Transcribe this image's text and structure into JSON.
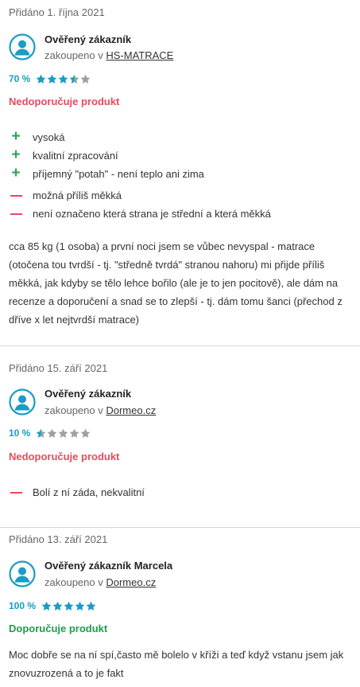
{
  "reviews": [
    {
      "date": "Přidáno 1. října 2021",
      "author": "Ověřený zákazník",
      "bought_prefix": "zakoupeno v",
      "shop": "HS-MATRACE",
      "rating_pct": "70 %",
      "rating_value": 3.5,
      "verdict": "Nedoporučuje produkt",
      "verdict_type": "negative",
      "pros": [
        "vysoká",
        "kvalitní zpracování",
        "příjemný \"potah\" - není teplo ani zima"
      ],
      "cons": [
        "možná příliš měkká",
        "není označeno která strana je střední a která měkká"
      ],
      "text": "cca 85 kg (1 osoba) a první noci jsem se vůbec nevyspal - matrace (otočena tou tvrdší - tj. \"středně tvrdá\" stranou nahoru) mi přijde příliš měkká, jak kdyby se tělo lehce bořilo (ale je to jen pocitově), ale dám na recenze a doporučení a snad se to zlepší - tj. dám tomu šanci (přechod z dříve x let nejtvrdší matrace)"
    },
    {
      "date": "Přidáno 15. září 2021",
      "author": "Ověřený zákazník",
      "bought_prefix": "zakoupeno v",
      "shop": "Dormeo.cz",
      "rating_pct": "10 %",
      "rating_value": 0.5,
      "verdict": "Nedoporučuje produkt",
      "verdict_type": "negative",
      "pros": [],
      "cons": [
        "Bolí z ní záda, nekvalitní"
      ],
      "text": ""
    },
    {
      "date": "Přidáno 13. září 2021",
      "author": "Ověřený zákazník Marcela",
      "bought_prefix": "zakoupeno v",
      "shop": "Dormeo.cz",
      "rating_pct": "100 %",
      "rating_value": 5,
      "verdict": "Doporučuje produkt",
      "verdict_type": "positive",
      "pros": [],
      "cons": [],
      "text": "Moc dobře se na ní spí,často mě bolelo v kříži a teď když vstanu jsem jak znovuzrozená a to je fakt"
    }
  ],
  "colors": {
    "accent": "#1a9cc4",
    "negative": "#e84a5f",
    "positive": "#1e9e4c",
    "plus": "#26a653",
    "star_empty": "#a0a0a0"
  },
  "icons": {
    "avatar": "user-avatar-icon",
    "star": "star-icon",
    "pro": "plus-icon",
    "con": "minus-icon"
  }
}
